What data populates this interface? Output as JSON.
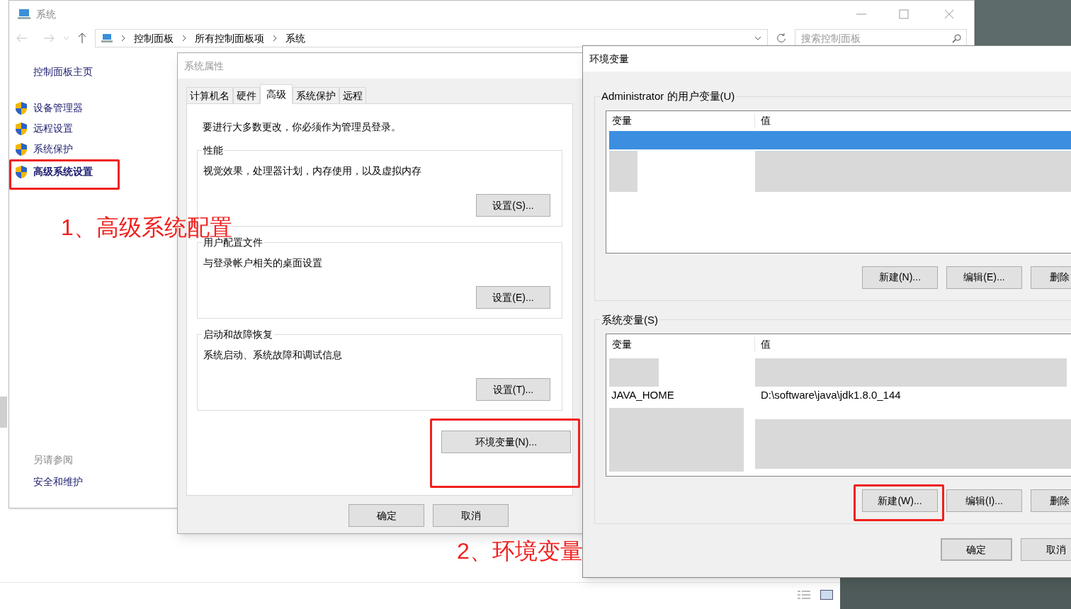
{
  "control_panel": {
    "title": "系统",
    "breadcrumb": [
      "控制面板",
      "所有控制面板项",
      "系统"
    ],
    "search": {
      "placeholder": "搜索控制面板"
    },
    "home_link": "控制面板主页",
    "links": [
      {
        "label": "设备管理器",
        "selected": false
      },
      {
        "label": "远程设置",
        "selected": false
      },
      {
        "label": "系统保护",
        "selected": false
      },
      {
        "label": "高级系统设置",
        "selected": true
      }
    ],
    "see_also": {
      "heading": "另请参阅",
      "links": [
        "安全和维护"
      ]
    }
  },
  "system_properties": {
    "title": "系统属性",
    "tabs": [
      {
        "label": "计算机名",
        "selected": false
      },
      {
        "label": "硬件",
        "selected": false
      },
      {
        "label": "高级",
        "selected": true
      },
      {
        "label": "系统保护",
        "selected": false
      },
      {
        "label": "远程",
        "selected": false
      }
    ],
    "notice": "要进行大多数更改，你必须作为管理员登录。",
    "groups": [
      {
        "title": "性能",
        "description": "视觉效果，处理器计划，内存使用，以及虚拟内存",
        "button": "设置(S)..."
      },
      {
        "title": "用户配置文件",
        "description": "与登录帐户相关的桌面设置",
        "button": "设置(E)..."
      },
      {
        "title": "启动和故障恢复",
        "description": "系统启动、系统故障和调试信息",
        "button": "设置(T)..."
      }
    ],
    "env_button": "环境变量(N)...",
    "buttons": [
      "确定",
      "取消"
    ]
  },
  "env_vars": {
    "title": "环境变量",
    "user_section": {
      "label": "Administrator 的用户变量(U)",
      "columns": [
        "变量",
        "值"
      ],
      "buttons": [
        "新建(N)...",
        "编辑(E)...",
        "删除"
      ]
    },
    "system_section": {
      "label": "系统变量(S)",
      "columns": [
        "变量",
        "值"
      ],
      "rows": [
        {
          "variable": "JAVA_HOME",
          "value": "D:\\software\\java\\jdk1.8.0_144"
        }
      ],
      "buttons": [
        "新建(W)...",
        "编辑(I)...",
        "删除"
      ]
    },
    "buttons": [
      "确定",
      "取消"
    ]
  },
  "annotations": [
    {
      "text": "1、高级系统配置"
    },
    {
      "text": "2、环境变量"
    }
  ]
}
